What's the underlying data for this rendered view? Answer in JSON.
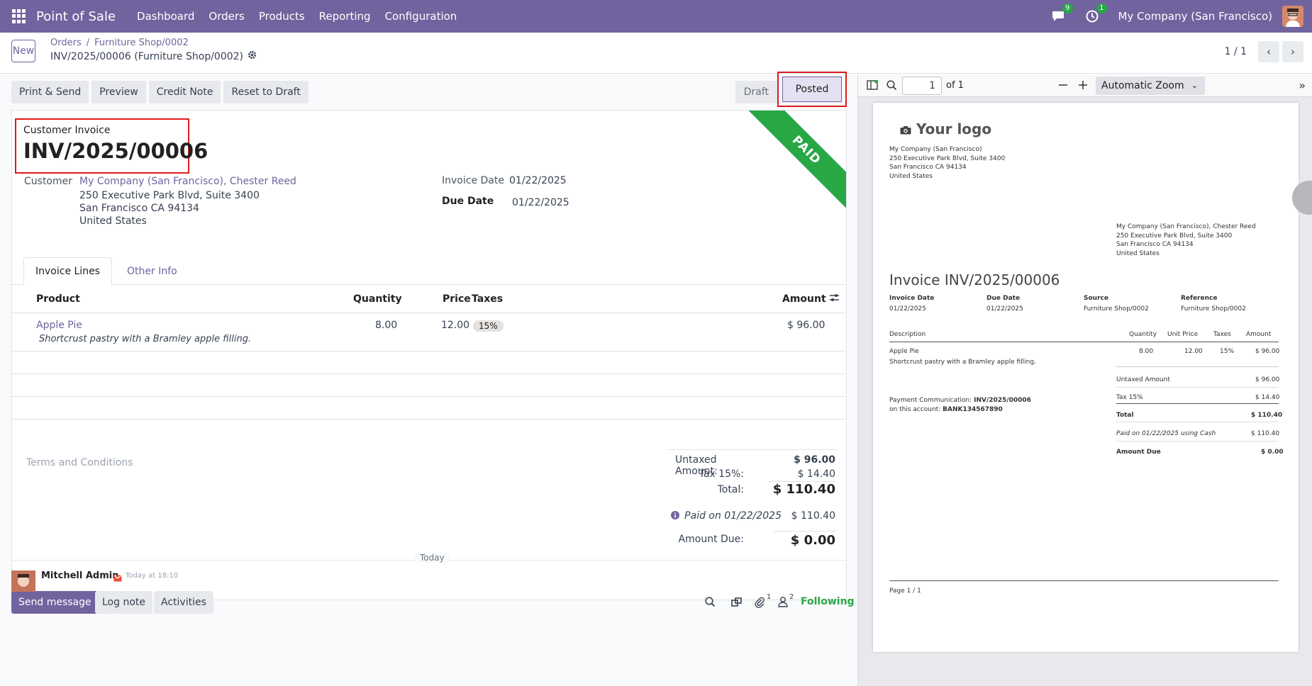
{
  "nav": {
    "app_name": "Point of Sale",
    "menu": [
      "Dashboard",
      "Orders",
      "Products",
      "Reporting",
      "Configuration"
    ],
    "messages_count": "9",
    "activities_count": "1",
    "company": "My Company (San Francisco)"
  },
  "control": {
    "new_label": "New",
    "breadcrumb": [
      "Orders",
      "Furniture Shop/0002"
    ],
    "record_name": "INV/2025/00006 (Furniture Shop/0002)",
    "pager": "1 / 1"
  },
  "actions": {
    "print_send": "Print & Send",
    "preview": "Preview",
    "credit_note": "Credit Note",
    "reset_draft": "Reset to Draft",
    "state_draft": "Draft",
    "state_posted": "Posted"
  },
  "invoice": {
    "ribbon": "PAID",
    "type_label": "Customer Invoice",
    "number": "INV/2025/00006",
    "customer_label": "Customer",
    "customer_name": "My Company (San Francisco), Chester Reed",
    "address": [
      "250 Executive Park Blvd, Suite 3400",
      "San Francisco CA 94134",
      "United States"
    ],
    "invoice_date_label": "Invoice Date",
    "invoice_date": "01/22/2025",
    "due_date_label": "Due Date",
    "due_date": "01/22/2025"
  },
  "tabs": [
    "Invoice Lines",
    "Other Info"
  ],
  "lines": {
    "headers": {
      "product": "Product",
      "quantity": "Quantity",
      "price": "Price",
      "taxes": "Taxes",
      "amount": "Amount"
    },
    "rows": [
      {
        "product": "Apple Pie",
        "description": "Shortcrust pastry with a Bramley apple filling.",
        "quantity": "8.00",
        "price": "12.00",
        "tax": "15%",
        "amount": "$ 96.00"
      }
    ]
  },
  "terms_placeholder": "Terms and Conditions",
  "totals": {
    "untaxed_label": "Untaxed Amount:",
    "untaxed": "$ 96.00",
    "tax_label": "Tax 15%:",
    "tax": "$ 14.40",
    "total_label": "Total:",
    "total": "$ 110.40",
    "paid_label": "Paid on 01/22/2025",
    "paid": "$ 110.40",
    "due_label": "Amount Due:",
    "due": "$ 0.00"
  },
  "chatter": {
    "send_message": "Send message",
    "log_note": "Log note",
    "activities": "Activities",
    "attachments_count": "1",
    "followers_count": "2",
    "following": "Following",
    "today": "Today",
    "author": "Mitchell Admin",
    "time": "Today at 18:10"
  },
  "pdf": {
    "page_input": "1",
    "page_of": "of 1",
    "zoom": "Automatic Zoom",
    "logo_text": "Your logo",
    "company_lines": [
      "My Company (San Francisco)",
      "250 Executive Park Blvd, Suite 3400",
      "San Francisco CA 94134",
      "United States"
    ],
    "customer_lines": [
      "My Company (San Francisco), Chester Reed",
      "250 Executive Park Blvd, Suite 3400",
      "San Francisco CA 94134",
      "United States"
    ],
    "title": "Invoice INV/2025/00006",
    "info": [
      {
        "label": "Invoice Date",
        "value": "01/22/2025"
      },
      {
        "label": "Due Date",
        "value": "01/22/2025"
      },
      {
        "label": "Source",
        "value": "Furniture Shop/0002"
      },
      {
        "label": "Reference",
        "value": "Furniture Shop/0002"
      }
    ],
    "table_headers": [
      "Description",
      "Quantity",
      "Unit Price",
      "Taxes",
      "Amount"
    ],
    "line": {
      "name": "Apple Pie",
      "desc": "Shortcrust pastry with a Bramley apple filling.",
      "qty": "8.00",
      "unit": "12.00",
      "tax": "15%",
      "amount": "$ 96.00"
    },
    "untaxed_label": "Untaxed Amount",
    "untaxed": "$ 96.00",
    "tax_label": "Tax 15%",
    "tax": "$ 14.40",
    "total_label": "Total",
    "total": "$ 110.40",
    "paid_label": "Paid on 01/22/2025 using Cash",
    "paid": "$ 110.40",
    "due_label": "Amount Due",
    "due": "$ 0.00",
    "payment_comm_label": "Payment Communication:",
    "payment_comm": "INV/2025/00006",
    "account_label": "on this account:",
    "account": "BANK134567890",
    "footer": "Page 1 / 1"
  },
  "colors": {
    "brand": "#71639e",
    "paid_ribbon": "#28a745",
    "highlight": "#e01a1a"
  }
}
